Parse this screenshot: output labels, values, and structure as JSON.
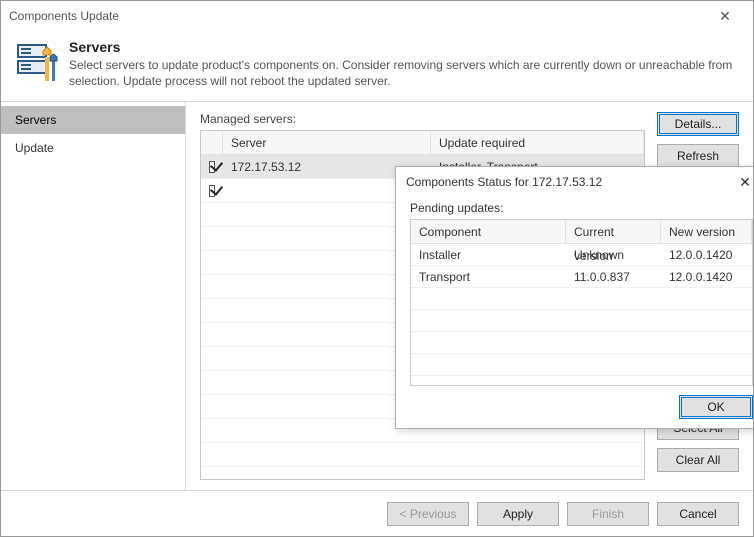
{
  "window": {
    "title": "Components Update"
  },
  "header": {
    "title": "Servers",
    "subtitle": "Select servers to update product's components on. Consider removing servers which are currently down or unreachable from selection. Update process will not reboot the updated server."
  },
  "sidebar": {
    "items": [
      {
        "label": "Servers",
        "selected": true
      },
      {
        "label": "Update",
        "selected": false
      }
    ]
  },
  "managed": {
    "label": "Managed servers:",
    "columns": {
      "server": "Server",
      "update": "Update required"
    },
    "rows": [
      {
        "checked": true,
        "server": "172.17.53.12",
        "update": "Installer, Transport",
        "selected": true
      },
      {
        "checked": true,
        "server": "",
        "update": "",
        "selected": false
      }
    ]
  },
  "buttons": {
    "details": "Details...",
    "refresh": "Refresh",
    "select_all": "Select All",
    "clear_all": "Clear All"
  },
  "footer": {
    "previous": "< Previous",
    "apply": "Apply",
    "finish": "Finish",
    "cancel": "Cancel"
  },
  "modal": {
    "title": "Components Status for 172.17.53.12",
    "label": "Pending updates:",
    "columns": {
      "component": "Component",
      "current": "Current version",
      "newv": "New version"
    },
    "rows": [
      {
        "component": "Installer",
        "current": "Unknown",
        "newv": "12.0.0.1420"
      },
      {
        "component": "Transport",
        "current": "11.0.0.837",
        "newv": "12.0.0.1420"
      }
    ],
    "ok": "OK"
  }
}
